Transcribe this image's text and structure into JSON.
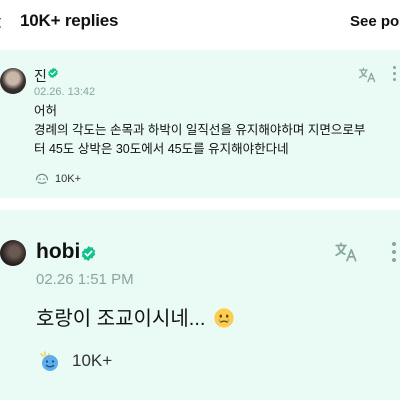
{
  "header": {
    "back_icon": "back-arrow-icon",
    "title": "10K+ replies",
    "see_post_label": "See pos"
  },
  "reply1": {
    "author": "진",
    "verified_icon": "verified-badge-icon",
    "timestamp": "02.26. 13:42",
    "line1": "어허",
    "line2": "경례의 각도는 손목과 하박이 일직선을 유지해야하며 지면으로부",
    "line3": "터 45도 상박은 30도에서 45도를 유지해야한다네",
    "reaction_count": "10K+",
    "translate_icon": "translate-icon",
    "more_icon": "more-vertical-icon",
    "reaction_icon": "reaction-icon"
  },
  "reply2": {
    "author": "hobi",
    "verified_icon": "verified-badge-icon",
    "timestamp": "02.26 1:51 PM",
    "text": "호랑이 조교이시네...",
    "emoji_icon": "holding-back-tears-emoji-icon",
    "reaction_count": "10K+",
    "translate_icon": "translate-icon",
    "more_icon": "more-vertical-icon",
    "reaction_icon": "reaction-icon"
  },
  "colors": {
    "card_background": "#e9fbf4",
    "accent": "#8aa79c",
    "verified": "#10c28b"
  }
}
